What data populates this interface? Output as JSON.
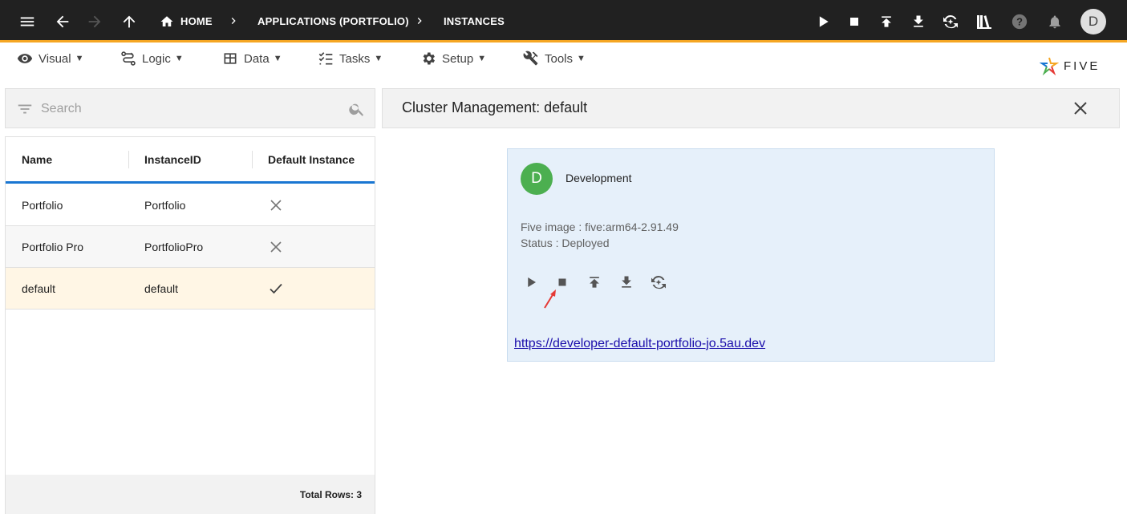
{
  "appbar": {
    "breadcrumbs": [
      {
        "label": "HOME",
        "icon": "home-icon"
      },
      {
        "label": "APPLICATIONS (PORTFOLIO)"
      },
      {
        "label": "INSTANCES"
      }
    ],
    "avatar_letter": "D",
    "accent_color": "#f5a623",
    "background_color": "#212121",
    "icons_left": [
      "menu-icon",
      "back-arrow-icon",
      "forward-arrow-icon",
      "up-arrow-icon"
    ],
    "icons_right": [
      "play-icon",
      "stop-icon",
      "deploy-upload-icon",
      "download-icon",
      "refresh-sync-icon",
      "library-icon",
      "help-icon",
      "notifications-bell-icon"
    ]
  },
  "menubar": {
    "items": [
      {
        "label": "Visual",
        "icon": "eye-icon"
      },
      {
        "label": "Logic",
        "icon": "logic-flow-icon"
      },
      {
        "label": "Data",
        "icon": "table-icon"
      },
      {
        "label": "Tasks",
        "icon": "checklist-icon"
      },
      {
        "label": "Setup",
        "icon": "gear-icon"
      },
      {
        "label": "Tools",
        "icon": "tools-icon"
      }
    ],
    "caret": "▼",
    "logo_text": "FIVE"
  },
  "search": {
    "placeholder": "Search",
    "value": ""
  },
  "grid": {
    "columns": [
      "Name",
      "InstanceID",
      "Default Instance"
    ],
    "rows": [
      {
        "name": "Portfolio",
        "instance_id": "Portfolio",
        "default": false,
        "selected": false
      },
      {
        "name": "Portfolio Pro",
        "instance_id": "PortfolioPro",
        "default": false,
        "selected": false
      },
      {
        "name": "default",
        "instance_id": "default",
        "default": true,
        "selected": true
      }
    ],
    "header_underline_color": "#1976d2",
    "selected_row_color": "#fff6e5",
    "footer": "Total Rows: 3"
  },
  "detail": {
    "title": "Cluster Management: default",
    "card": {
      "avatar_letter": "D",
      "avatar_color": "#4caf50",
      "name": "Development",
      "image": "Five image : five:arm64-2.91.49",
      "status": "Status : Deployed",
      "actions": [
        "play-icon",
        "stop-icon",
        "deploy-upload-icon",
        "download-icon",
        "refresh-sync-icon"
      ],
      "link": "https://developer-default-portfolio-jo.5au.dev",
      "background_color": "#e6f0fa"
    },
    "annotation_color": "#e53935"
  }
}
